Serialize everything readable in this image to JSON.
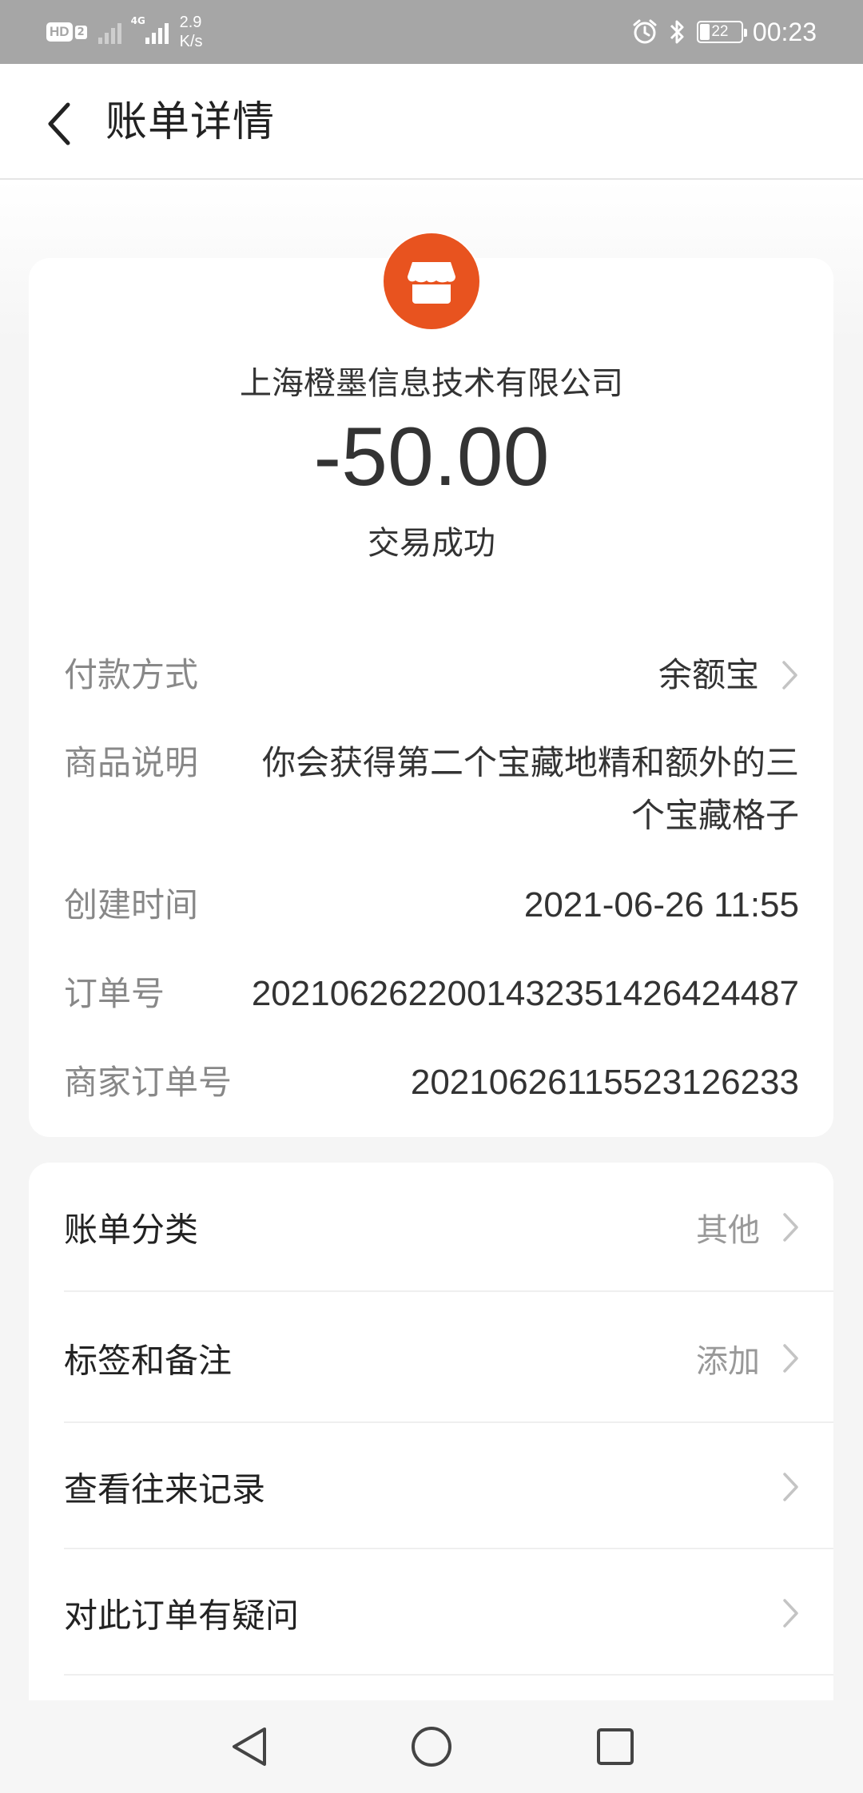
{
  "status_bar": {
    "hd_label": "HD",
    "hd_sub": "2",
    "network_tag": "4G",
    "net_speed_value": "2.9",
    "net_speed_unit": "K/s",
    "battery_level": "22",
    "time": "00:23"
  },
  "header": {
    "title": "账单详情"
  },
  "merchant": {
    "name": "上海橙墨信息技术有限公司",
    "logo_color": "#e8531f",
    "amount": "-50.00",
    "status": "交易成功"
  },
  "details": {
    "payment_method": {
      "label": "付款方式",
      "value": "余额宝"
    },
    "product_desc": {
      "label": "商品说明",
      "value": "你会获得第二个宝藏地精和额外的三个宝藏格子"
    },
    "created_time": {
      "label": "创建时间",
      "value": "2021-06-26 11:55"
    },
    "order_no": {
      "label": "订单号",
      "value": "2021062622001432351426424487"
    },
    "merchant_order_no": {
      "label": "商家订单号",
      "value": "20210626115523126233"
    }
  },
  "menu": {
    "bill_category": {
      "label": "账单分类",
      "hint": "其他"
    },
    "tags_notes": {
      "label": "标签和备注",
      "hint": "添加"
    },
    "view_records": {
      "label": "查看往来记录"
    },
    "order_question": {
      "label": "对此订单有疑问"
    }
  }
}
